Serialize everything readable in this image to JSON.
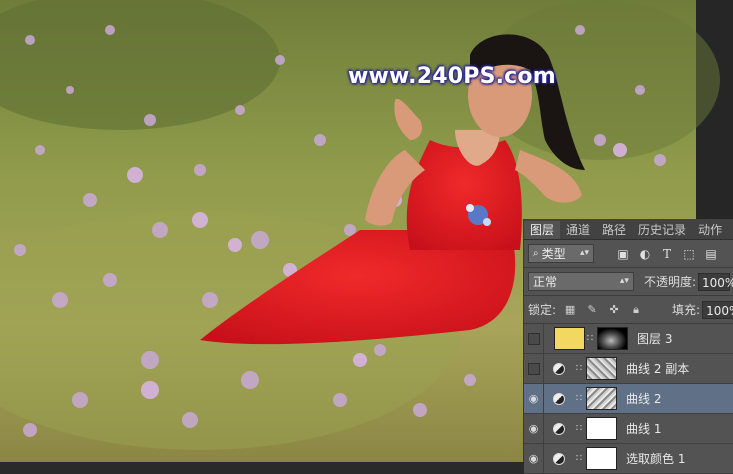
{
  "watermark": {
    "text": "www.240PS.com"
  },
  "panel": {
    "tabs": [
      {
        "label": "图层",
        "active": true
      },
      {
        "label": "通道",
        "active": false
      },
      {
        "label": "路径",
        "active": false
      },
      {
        "label": "历史记录",
        "active": false
      },
      {
        "label": "动作",
        "active": false
      }
    ],
    "filter": {
      "kind_label": "类型",
      "icons": [
        "image-filter-icon",
        "adjustment-filter-icon",
        "text-filter-icon",
        "shape-filter-icon",
        "smart-object-filter-icon"
      ]
    },
    "blend": {
      "mode": "正常",
      "opacity_label": "不透明度:",
      "opacity_value": "100%"
    },
    "lock": {
      "label": "锁定:",
      "fill_label": "填充:",
      "fill_value": "100%"
    },
    "layers": [
      {
        "name": "图层 3",
        "visible": false,
        "selected": false,
        "thumb": "yellow",
        "mask": "dark-vignette"
      },
      {
        "name": "曲线 2 副本",
        "visible": false,
        "selected": false,
        "thumb": "adjustment",
        "mask": "texture"
      },
      {
        "name": "曲线 2",
        "visible": true,
        "selected": true,
        "thumb": "adjustment",
        "mask": "texture"
      },
      {
        "name": "曲线 1",
        "visible": true,
        "selected": false,
        "thumb": "adjustment",
        "mask": "white"
      },
      {
        "name": "选取颜色 1",
        "visible": true,
        "selected": false,
        "thumb": "adjustment",
        "mask": "white"
      }
    ],
    "colors": {
      "panel": "#535353",
      "selected_row": "#5f7087",
      "layer3_fill": "#f2d760"
    }
  }
}
